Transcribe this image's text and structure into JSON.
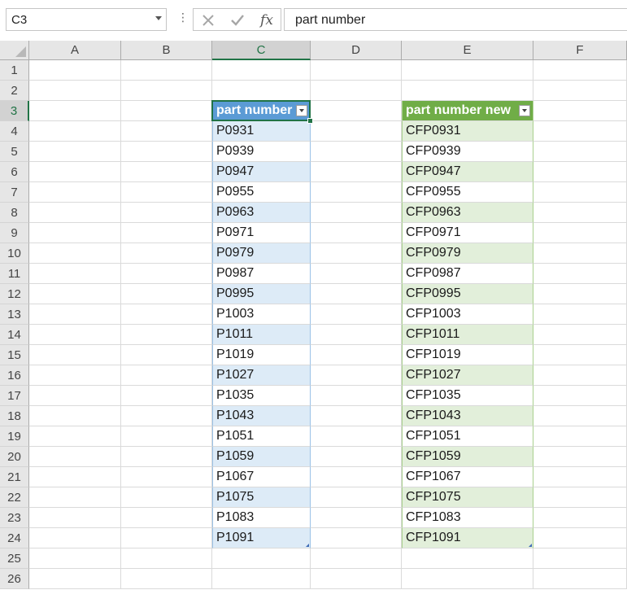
{
  "formula_bar": {
    "name_box": "C3",
    "more_glyph": "⋮",
    "cancel_icon": "cancel-icon",
    "enter_icon": "enter-icon",
    "fx_label": "fx",
    "formula": "part number"
  },
  "columns": [
    "A",
    "B",
    "C",
    "D",
    "E",
    "F"
  ],
  "rows": [
    "1",
    "2",
    "3",
    "4",
    "5",
    "6",
    "7",
    "8",
    "9",
    "10",
    "11",
    "12",
    "13",
    "14",
    "15",
    "16",
    "17",
    "18",
    "19",
    "20",
    "21",
    "22",
    "23",
    "24",
    "25",
    "26"
  ],
  "selected": {
    "cell": "C3",
    "column": "C",
    "row": "3"
  },
  "table1": {
    "header": "part number",
    "values": [
      "P0931",
      "P0939",
      "P0947",
      "P0955",
      "P0963",
      "P0971",
      "P0979",
      "P0987",
      "P0995",
      "P1003",
      "P1011",
      "P1019",
      "P1027",
      "P1035",
      "P1043",
      "P1051",
      "P1059",
      "P1067",
      "P1075",
      "P1083",
      "P1091"
    ]
  },
  "table2": {
    "header": "part number new",
    "values": [
      "CFP0931",
      "CFP0939",
      "CFP0947",
      "CFP0955",
      "CFP0963",
      "CFP0971",
      "CFP0979",
      "CFP0987",
      "CFP0995",
      "CFP1003",
      "CFP1011",
      "CFP1019",
      "CFP1027",
      "CFP1035",
      "CFP1043",
      "CFP1051",
      "CFP1059",
      "CFP1067",
      "CFP1075",
      "CFP1083",
      "CFP1091"
    ]
  },
  "colors": {
    "accent": "#217346",
    "table1_header": "#5b9bd5",
    "table1_band": "#ddebf7",
    "table2_header": "#70ad47",
    "table2_band": "#e2efda"
  }
}
